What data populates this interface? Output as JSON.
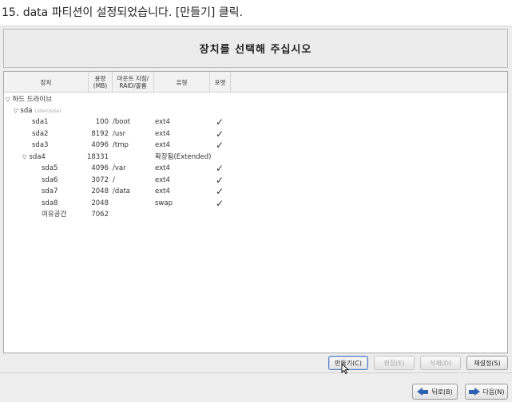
{
  "caption": "15. data 파티션이 설정되었습니다. [만들기] 클릭.",
  "header": {
    "title": "장치를 선택해 주십시오"
  },
  "columns": {
    "device": "장치",
    "size": "용량\n(MB)",
    "mount": "마운트 지점/\nRAID/볼륨",
    "type": "유형",
    "format": "포맷"
  },
  "tree": {
    "root": "하드 드라이브",
    "disk": {
      "name": "sda",
      "path": "/dev/sda"
    },
    "partitions": [
      {
        "name": "sda1",
        "size": "100",
        "mount": "/boot",
        "type": "ext4",
        "format": true,
        "level": 2
      },
      {
        "name": "sda2",
        "size": "8192",
        "mount": "/usr",
        "type": "ext4",
        "format": true,
        "level": 2
      },
      {
        "name": "sda3",
        "size": "4096",
        "mount": "/tmp",
        "type": "ext4",
        "format": true,
        "level": 2
      },
      {
        "name": "sda4",
        "size": "18331",
        "mount": "",
        "type": "확장됨(Extended)",
        "format": false,
        "level": 2,
        "expander": true
      },
      {
        "name": "sda5",
        "size": "4096",
        "mount": "/var",
        "type": "ext4",
        "format": true,
        "level": 3
      },
      {
        "name": "sda6",
        "size": "3072",
        "mount": "/",
        "type": "ext4",
        "format": true,
        "level": 3
      },
      {
        "name": "sda7",
        "size": "2048",
        "mount": "/data",
        "type": "ext4",
        "format": true,
        "level": 3
      },
      {
        "name": "sda8",
        "size": "2048",
        "mount": "",
        "type": "swap",
        "format": true,
        "level": 3
      },
      {
        "name": "여유공간",
        "size": "7062",
        "mount": "",
        "type": "",
        "format": false,
        "level": 3
      }
    ],
    "check_glyph": "✓",
    "expander_glyph": "▽"
  },
  "actions": {
    "create": "만들기(C)",
    "edit": "편집(E)",
    "delete": "삭제(D)",
    "reset": "재설정(S)"
  },
  "nav": {
    "back": "뒤로(B)",
    "next": "다음(N)"
  }
}
